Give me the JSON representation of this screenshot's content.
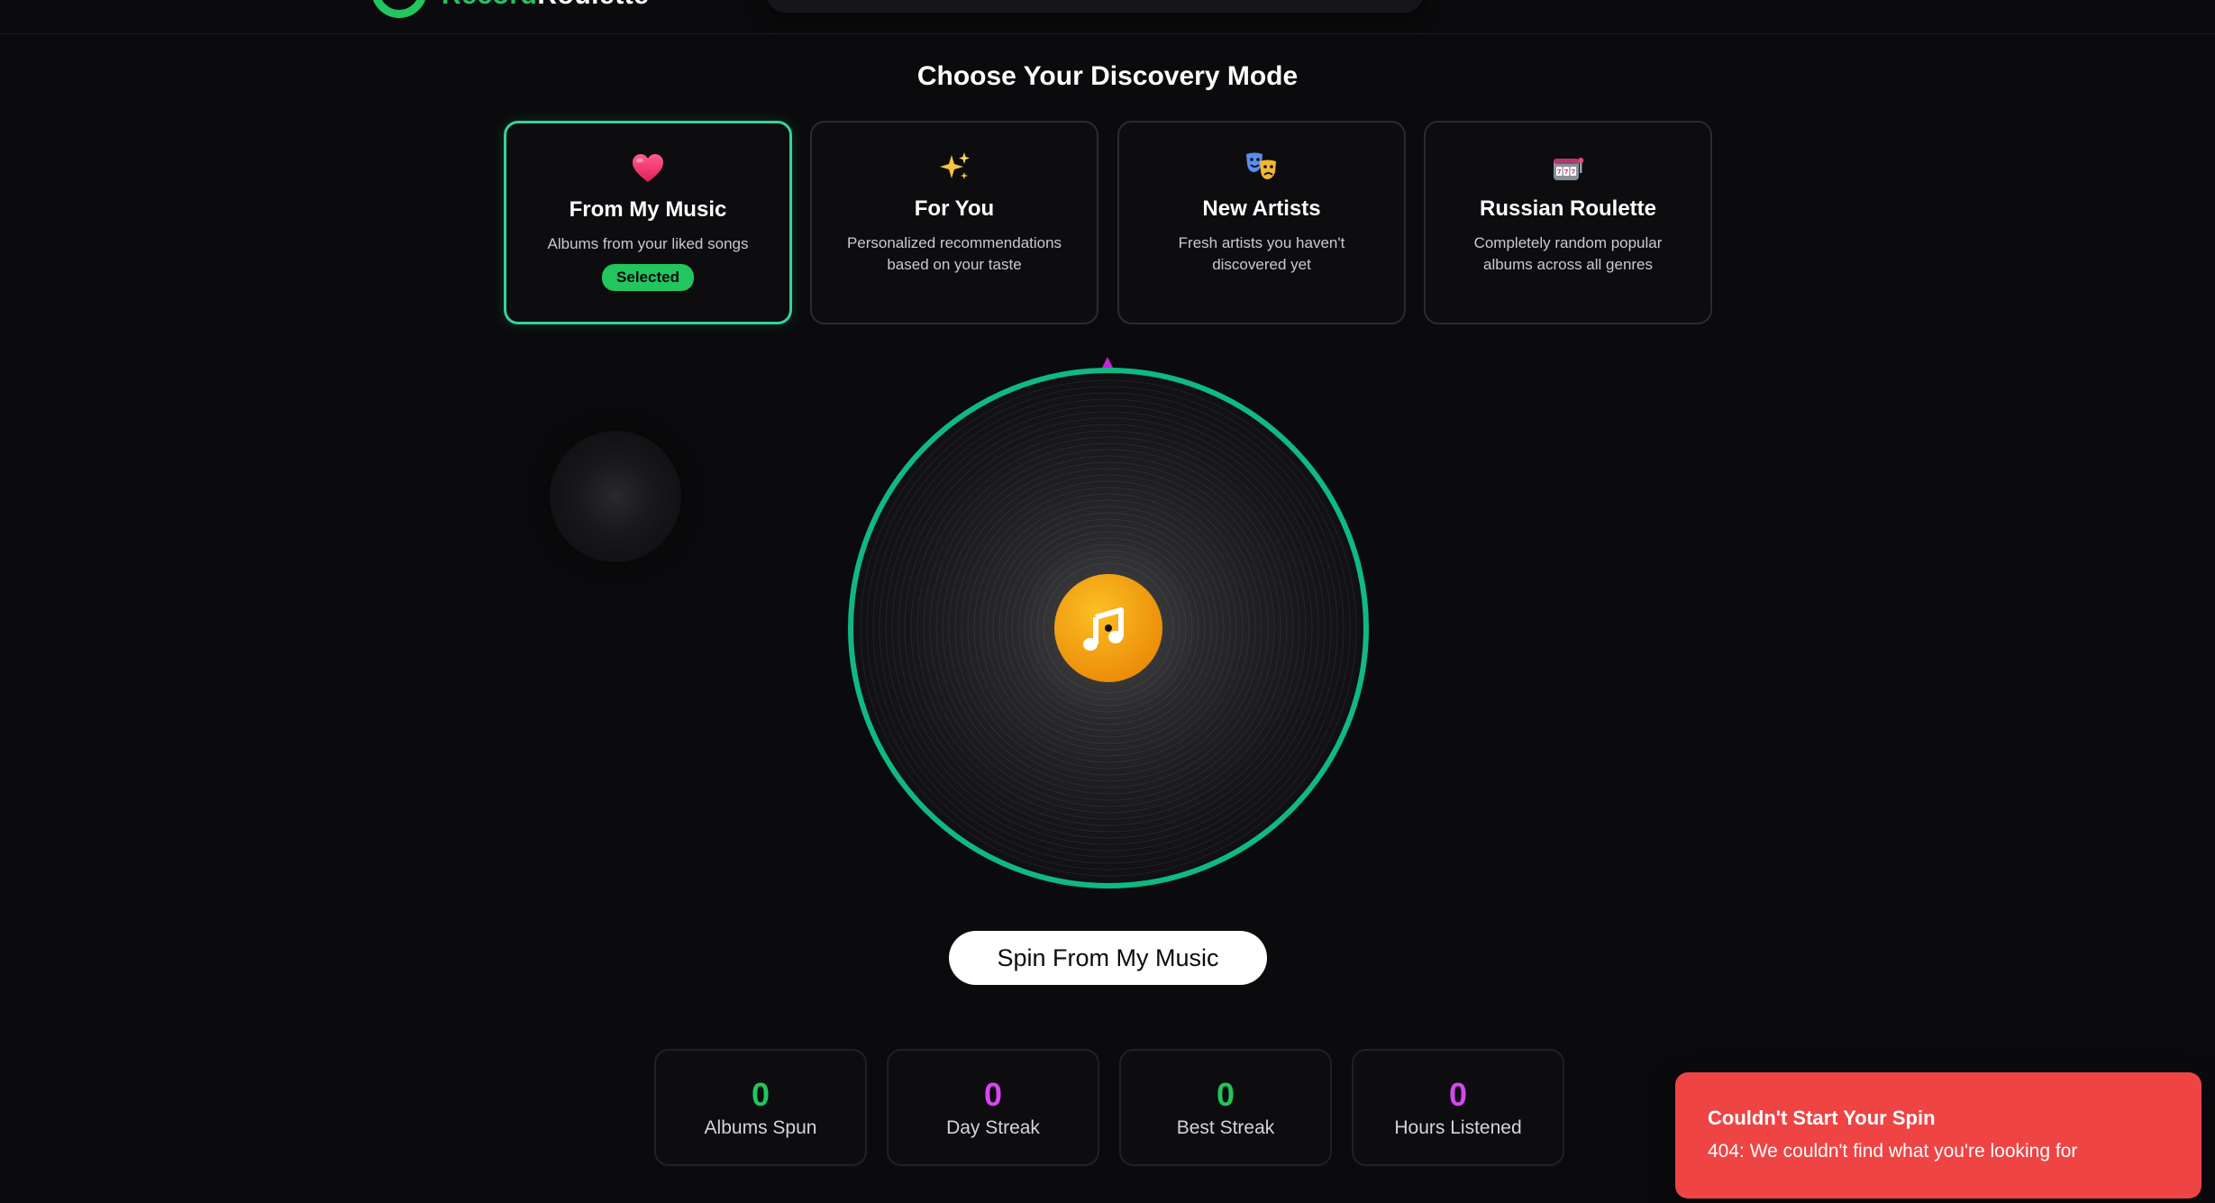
{
  "header": {
    "brand_part1": "Record",
    "brand_part2": "Roulette"
  },
  "discovery": {
    "title": "Choose Your Discovery Mode",
    "modes": [
      {
        "icon": "heart-icon",
        "title": "From My Music",
        "description": "Albums from your liked songs",
        "badge": "Selected",
        "selected": true
      },
      {
        "icon": "sparkles-icon",
        "title": "For You",
        "description": "Personalized recommendations based on your taste",
        "selected": false
      },
      {
        "icon": "theater-masks-icon",
        "title": "New Artists",
        "description": "Fresh artists you haven't discovered yet",
        "selected": false
      },
      {
        "icon": "slot-machine-icon",
        "title": "Russian Roulette",
        "description": "Completely random popular albums across all genres",
        "selected": false
      }
    ]
  },
  "vinyl": {
    "center_icon": "music-note-icon",
    "ring_color": "#10b981",
    "label_color": "#f59e0b",
    "pointer_color": "#c026d3"
  },
  "spin_button": {
    "label": "Spin From My Music"
  },
  "stats": [
    {
      "value": "0",
      "label": "Albums Spun",
      "color": "#22c55e"
    },
    {
      "value": "0",
      "label": "Day Streak",
      "color": "#d946ef"
    },
    {
      "value": "0",
      "label": "Best Streak",
      "color": "#22c55e"
    },
    {
      "value": "0",
      "label": "Hours Listened",
      "color": "#d946ef"
    }
  ],
  "toast": {
    "title": "Couldn't Start Your Spin",
    "message": "404: We couldn't find what you're looking for",
    "color": "#ef4444"
  },
  "colors": {
    "background": "#0b0b0d",
    "accent_green": "#22c55e",
    "accent_magenta": "#d946ef"
  }
}
